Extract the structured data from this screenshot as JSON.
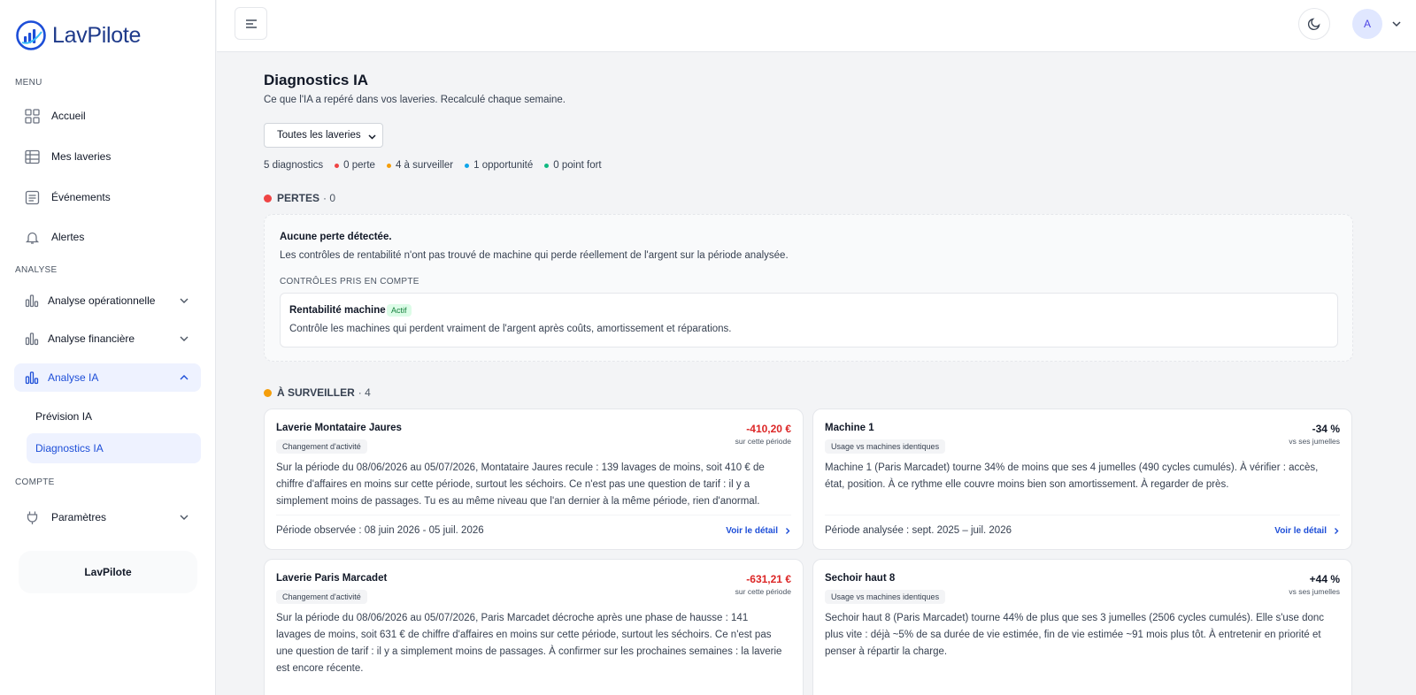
{
  "app": {
    "name": "LavPilote"
  },
  "sidebar": {
    "sections": {
      "menu": "MENU",
      "analyse": "ANALYSE",
      "compte": "COMPTE"
    },
    "items": [
      {
        "label": "Accueil",
        "icon": "grid-icon"
      },
      {
        "label": "Mes laveries",
        "icon": "table-icon"
      },
      {
        "label": "Événements",
        "icon": "document-icon"
      },
      {
        "label": "Alertes",
        "icon": "bell-icon"
      },
      {
        "label": "Analyse opérationnelle",
        "icon": "chart-icon"
      },
      {
        "label": "Analyse financière",
        "icon": "chart-icon"
      },
      {
        "label": "Analyse IA",
        "icon": "chart-icon"
      },
      {
        "label": "Paramètres",
        "icon": "plug-icon"
      }
    ],
    "sub_items": [
      {
        "label": "Prévision IA"
      },
      {
        "label": "Diagnostics IA"
      }
    ],
    "brand_footer": "LavPilote"
  },
  "topbar": {
    "avatar_initial": "A"
  },
  "page": {
    "title": "Diagnostics IA",
    "subtitle": "Ce que l'IA a repéré dans vos laveries. Recalculé chaque semaine.",
    "filter_value": "Toutes les laveries",
    "summary": {
      "total": "5 diagnostics",
      "loss": "0 perte",
      "watch": "4 à surveiller",
      "opportunity": "1 opportunité",
      "strength": "0 point fort"
    }
  },
  "colors": {
    "accent": "#1d4ed8",
    "loss": "#ef4444",
    "watch": "#f59e0b",
    "opportunity": "#0ea5e9",
    "strength": "#10b981"
  },
  "pertes": {
    "heading": "PERTES",
    "count": "· 0",
    "title": "Aucune perte détectée.",
    "description": "Les contrôles de rentabilité n'ont pas trouvé de machine qui perde réellement de l'argent sur la période analysée.",
    "controls_label": "CONTRÔLES PRIS EN COMPTE",
    "control": {
      "name": "Rentabilité machine",
      "badge": "Actif",
      "description": "Contrôle les machines qui perdent vraiment de l'argent après coûts, amortissement et réparations."
    }
  },
  "surveiller": {
    "heading": "À SURVEILLER",
    "count": "· 4",
    "cards": [
      {
        "title": "Laverie Montataire Jaures",
        "badge": "Changement d'activité",
        "value": "-410,20 €",
        "value_unit": "sur cette période",
        "body": "Sur la période du 08/06/2026 au 05/07/2026, Montataire Jaures recule : 139 lavages de moins, soit 410 € de chiffre d'affaires en moins sur cette période, surtout les séchoirs. Ce n'est pas une question de tarif : il y a simplement moins de passages. Tu es au même niveau que l'an dernier à la même période, rien d'anormal.",
        "period": "Période observée : 08 juin 2026 - 05 juil. 2026",
        "link": "Voir le détail"
      },
      {
        "title": "Machine 1",
        "badge": "Usage vs machines identiques",
        "value": "-34 %",
        "value_unit": "vs ses jumelles",
        "body": "Machine 1 (Paris Marcadet) tourne 34% de moins que ses 4 jumelles (490 cycles cumulés). À vérifier : accès, état, position. À ce rythme elle couvre moins bien son amortissement. À regarder de près.",
        "period": "Période analysée : sept. 2025 – juil. 2026",
        "link": "Voir le détail"
      },
      {
        "title": "Laverie Paris Marcadet",
        "badge": "Changement d'activité",
        "value": "-631,21 €",
        "value_unit": "sur cette période",
        "body": "Sur la période du 08/06/2026 au 05/07/2026, Paris Marcadet décroche après une phase de hausse : 141 lavages de moins, soit 631 € de chiffre d'affaires en moins sur cette période, surtout les séchoirs. Ce n'est pas une question de tarif : il y a simplement moins de passages. À confirmer sur les prochaines semaines : la laverie est encore récente."
      },
      {
        "title": "Sechoir haut 8",
        "badge": "Usage vs machines identiques",
        "value": "+44 %",
        "value_unit": "vs ses jumelles",
        "body": "Sechoir haut 8 (Paris Marcadet) tourne 44% de plus que ses 3 jumelles (2506 cycles cumulés). Elle s'use donc plus vite : déjà ~5% de sa durée de vie estimée, fin de vie estimée ~91 mois plus tôt. À entretenir en priorité et penser à répartir la charge."
      }
    ]
  }
}
